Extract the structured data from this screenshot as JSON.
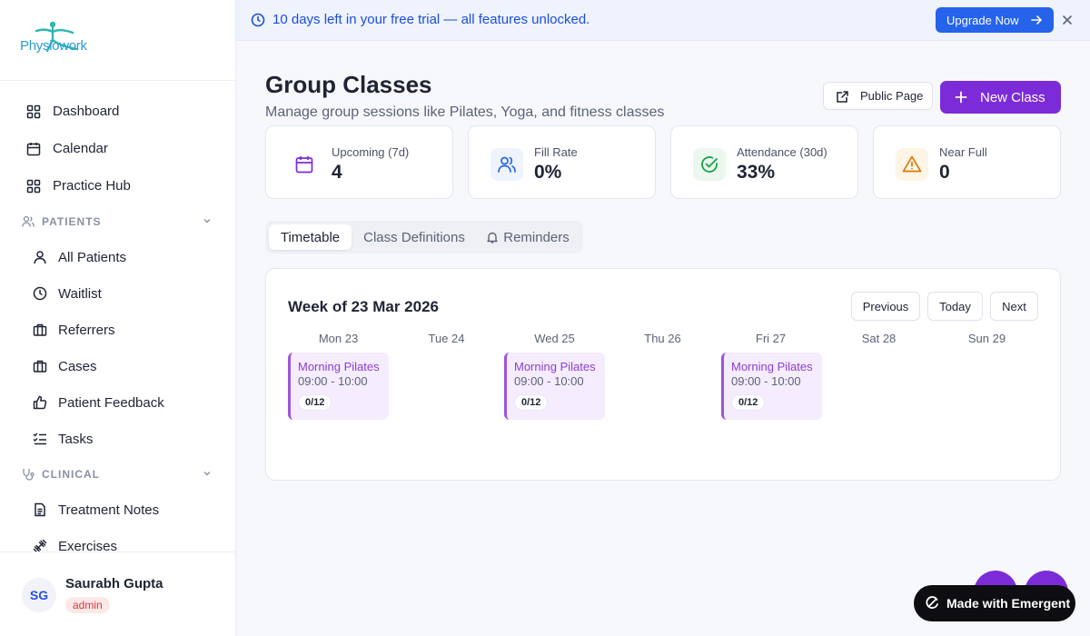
{
  "app": {
    "logo_text": "Physiowork"
  },
  "sidebar": {
    "top_items": [
      {
        "label": "Dashboard",
        "icon": "grid-icon"
      },
      {
        "label": "Calendar",
        "icon": "calendar-icon"
      },
      {
        "label": "Practice Hub",
        "icon": "grid-icon"
      }
    ],
    "sections": [
      {
        "title": "PATIENTS",
        "icon": "users-icon",
        "items": [
          {
            "label": "All Patients",
            "icon": "user-icon"
          },
          {
            "label": "Waitlist",
            "icon": "clock-icon"
          },
          {
            "label": "Referrers",
            "icon": "briefcase-icon"
          },
          {
            "label": "Cases",
            "icon": "briefcase-icon"
          },
          {
            "label": "Patient Feedback",
            "icon": "thumbs-up-icon"
          },
          {
            "label": "Tasks",
            "icon": "list-checks-icon"
          }
        ]
      },
      {
        "title": "CLINICAL",
        "icon": "stethoscope-icon",
        "items": [
          {
            "label": "Treatment Notes",
            "icon": "file-text-icon"
          },
          {
            "label": "Exercises",
            "icon": "dumbbell-icon"
          }
        ]
      }
    ],
    "user": {
      "initials": "SG",
      "name": "Saurabh Gupta",
      "role": "admin"
    }
  },
  "banner": {
    "text": "10 days left in your free trial — all features unlocked.",
    "cta": "Upgrade Now",
    "color": "#1d4ed8"
  },
  "header": {
    "title": "Group Classes",
    "subtitle": "Manage group sessions like Pilates, Yoga, and fitness classes",
    "public_page_label": "Public Page",
    "new_class_label": "New Class",
    "accent": "#7c2bd9"
  },
  "stats": [
    {
      "label": "Upcoming (7d)",
      "value": "4",
      "icon": "calendar-icon",
      "color": "#7c2bd9"
    },
    {
      "label": "Fill Rate",
      "value": "0%",
      "icon": "users-icon",
      "color": "#2563eb"
    },
    {
      "label": "Attendance (30d)",
      "value": "33%",
      "icon": "check-circle-icon",
      "color": "#16a34a"
    },
    {
      "label": "Near Full",
      "value": "0",
      "icon": "alert-triangle-icon",
      "color": "#d97706"
    }
  ],
  "tabs": [
    {
      "label": "Timetable",
      "active": true
    },
    {
      "label": "Class Definitions",
      "active": false
    },
    {
      "label": "Reminders",
      "active": false,
      "icon": "bell-icon"
    }
  ],
  "timetable": {
    "week_title": "Week of 23 Mar 2026",
    "previous_label": "Previous",
    "today_label": "Today",
    "next_label": "Next",
    "days": [
      "Mon 23",
      "Tue 24",
      "Wed 25",
      "Thu 26",
      "Fri 27",
      "Sat 28",
      "Sun 29"
    ],
    "sessions": [
      {
        "day": "Mon 23",
        "name": "Morning Pilates",
        "time": "09:00 - 10:00",
        "capacity": "0/12"
      },
      {
        "day": "Wed 25",
        "name": "Morning Pilates",
        "time": "09:00 - 10:00",
        "capacity": "0/12"
      },
      {
        "day": "Fri 27",
        "name": "Morning Pilates",
        "time": "09:00 - 10:00",
        "capacity": "0/12"
      }
    ]
  },
  "footer_badge": {
    "label": "Made with Emergent"
  }
}
